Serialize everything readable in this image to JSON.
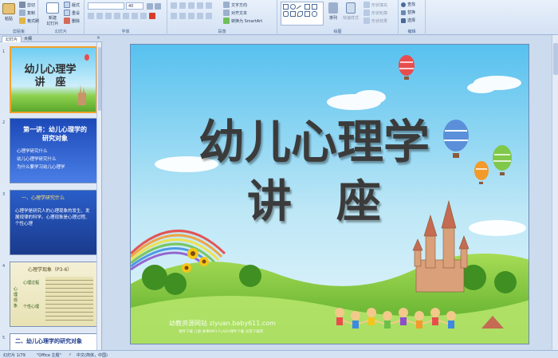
{
  "ribbon": {
    "clipboard": {
      "label": "剪贴板",
      "paste": "粘贴",
      "cut": "剪切",
      "copy": "复制",
      "format_painter": "格式刷"
    },
    "slides": {
      "label": "幻灯片",
      "new_slide": "新建\n幻灯片",
      "layout": "版式",
      "reset": "重设",
      "delete": "删除"
    },
    "font": {
      "label": "字体",
      "size": "40"
    },
    "paragraph": {
      "label": "段落",
      "text_direction": "文字方向",
      "align_text": "对齐文本",
      "smartart": "转换为 SmartArt"
    },
    "drawing": {
      "label": "绘图",
      "arrange": "排列",
      "quick_styles": "快速样式",
      "shape_fill": "形状填充",
      "shape_outline": "形状轮廓",
      "shape_effects": "形状效果"
    },
    "editing": {
      "label": "编辑",
      "find": "查找",
      "replace": "替换",
      "select": "选择"
    }
  },
  "left_pane": {
    "tab_slides": "幻灯片",
    "tab_outline": "大纲",
    "thumbs": [
      {
        "num": "1",
        "title": "幼儿心理学\n讲　座"
      },
      {
        "num": "2",
        "title": "第一讲：幼儿心理学的\n研究对象",
        "bullets": [
          "心理学研究什么",
          "幼儿心理学研究什么",
          "为什么要学习幼儿心理学"
        ]
      },
      {
        "num": "3",
        "title": "一、心理学研究什么",
        "body": "心理学是研究人的心理现象的发生、发展规律的科学。心理现象是心理过程、个性心理"
      },
      {
        "num": "4",
        "title": "心理学现象（P3-6）",
        "labels": [
          "心理现象",
          "心理过程",
          "个性心理"
        ]
      },
      {
        "num": "5",
        "title": "二、幼儿心理学的研究对象"
      }
    ]
  },
  "slide": {
    "title_line1": "幼儿心理学",
    "title_line2": "讲　座",
    "watermark_site": "幼教资源网站  ziyuan.baby611.com",
    "watermark_sub": "课件下载  儿歌  故事MP3  FLASH课件下载  试卷下载等"
  },
  "status": {
    "slide_info": "幻灯片 1/79",
    "theme": "\"Office 主题\"",
    "language": "中文(简体，中国)"
  },
  "colors": {
    "sky_top": "#57c1ef",
    "sky_bottom": "#bde7f6",
    "grass": "#7cc43a",
    "title_text": "#3b3b3b"
  }
}
